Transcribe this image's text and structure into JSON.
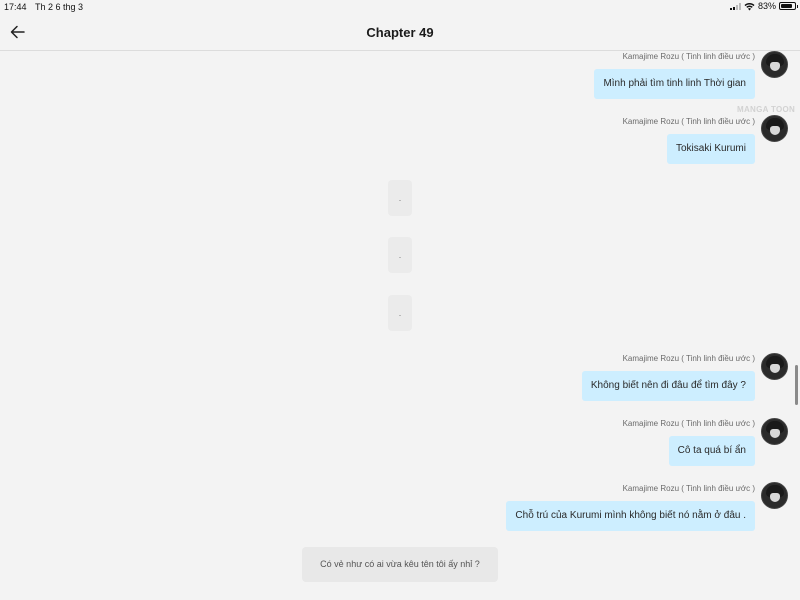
{
  "status_bar": {
    "time": "17:44",
    "date": "Th 2 6 thg 3",
    "battery": "83%",
    "battery_level": 0.83
  },
  "header": {
    "title": "Chapter 49",
    "back_icon": "arrow-left-icon"
  },
  "watermark": "MANGA TOON",
  "messages": [
    {
      "speaker": "Kamajime Rozu ( Tinh linh điều ước )",
      "text": "Mình phải tìm tinh linh Thời gian"
    },
    {
      "speaker": "Kamajime Rozu ( Tinh linh điều ước )",
      "text": "Tokisaki Kurumi"
    },
    {
      "speaker": "Kamajime Rozu ( Tinh linh điều ước )",
      "text": "Không biết nên đi đâu để tìm đây ?"
    },
    {
      "speaker": "Kamajime Rozu ( Tinh linh điều ước )",
      "text": "Cô ta quá bí ẩn"
    },
    {
      "speaker": "Kamajime Rozu ( Tinh linh điều ước )",
      "text": "Chỗ trú của Kurumi mình không biết nó nằm ở đâu ."
    }
  ],
  "dots": [
    ".",
    ".",
    "."
  ],
  "narration": "Có vẻ như có ai vừa kêu tên tôi ấy nhỉ ?",
  "colors": {
    "bubble": "#cdeeff",
    "background": "#f3f3f3"
  }
}
